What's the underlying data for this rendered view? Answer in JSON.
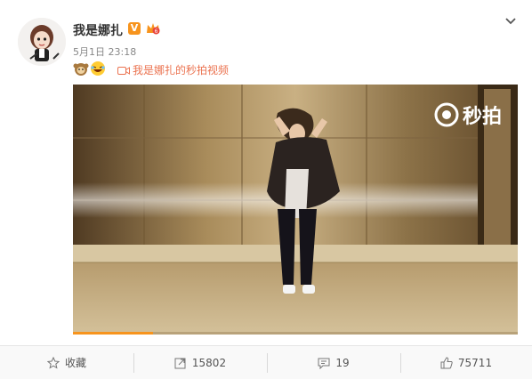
{
  "post": {
    "username": "我是娜扎",
    "verified_badge": "V",
    "timestamp": "5月1日 23:18",
    "emojis": [
      "monkey-emoji",
      "laughing-emoji"
    ],
    "video_link_text": "我是娜扎的秒拍视频"
  },
  "video": {
    "watermark_text": "秒拍",
    "progress_fraction": 0.18
  },
  "actions": {
    "favorite_label": "收藏",
    "repost_count": "15802",
    "comment_count": "19",
    "like_count": "75711"
  },
  "colors": {
    "link": "#eb7350",
    "badge": "#f7941d",
    "progress": "#f7941d"
  }
}
